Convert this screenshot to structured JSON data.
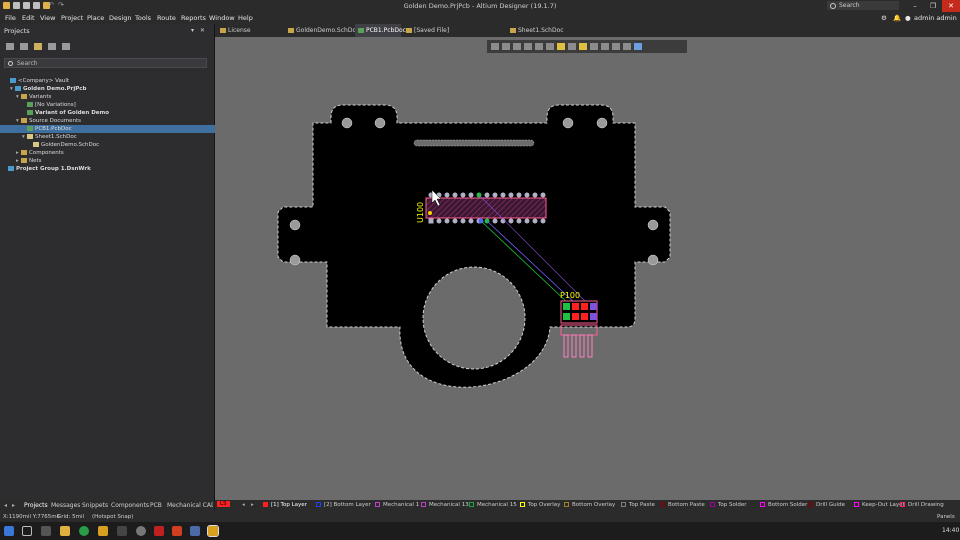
{
  "window": {
    "title": "Golden Demo.PrjPcb - Altium Designer (19.1.7)",
    "search_placeholder": "Search",
    "buttons": {
      "minimize": "–",
      "maximize": "❐",
      "close": "✕"
    }
  },
  "menu": {
    "items": [
      "File",
      "Edit",
      "View",
      "Project",
      "Place",
      "Design",
      "Tools",
      "Route",
      "Reports",
      "Window",
      "Help"
    ],
    "user": "admin admin"
  },
  "projects_panel": {
    "title": "Projects",
    "controls": "▾ ✕",
    "search_placeholder": "Search",
    "tree": [
      {
        "label": "<Company> Vault"
      },
      {
        "label": "Golden Demo.PrjPcb"
      },
      {
        "label": "Variants"
      },
      {
        "label": "[No Variations]"
      },
      {
        "label": "Variant of Golden Demo"
      },
      {
        "label": "Source Documents"
      },
      {
        "label": "PCB1.PcbDoc"
      },
      {
        "label": "Sheet1.SchDoc"
      },
      {
        "label": "GoldenDemo.SchDoc"
      },
      {
        "label": "Components"
      },
      {
        "label": "Nets"
      },
      {
        "label": "Project Group 1.DsnWrk"
      }
    ],
    "tabs": [
      "Projects",
      "Messages",
      "Snippets",
      "Components",
      "PCB",
      "Mechanical CAD C"
    ]
  },
  "doc_tabs": [
    {
      "label": "License Management"
    },
    {
      "label": "GoldenDemo.SchDoc"
    },
    {
      "label": "PCB1.PcbDoc"
    },
    {
      "label": "[Saved File] GoldenDemo.SchDoc *"
    },
    {
      "label": "Sheet1.SchDoc"
    }
  ],
  "pcb": {
    "designator_u": "U100",
    "designator_p": "P100"
  },
  "layers": {
    "current": "LS",
    "items": [
      {
        "label": "[1] Top Layer",
        "color": "#ff2020"
      },
      {
        "label": "[2] Bottom Layer",
        "color": "#2040ff"
      },
      {
        "label": "Mechanical 1",
        "color": "#c040c0"
      },
      {
        "label": "Mechanical 13",
        "color": "#c040c0"
      },
      {
        "label": "Mechanical 15",
        "color": "#20a040"
      },
      {
        "label": "Top Overlay",
        "color": "#ffff00"
      },
      {
        "label": "Bottom Overlay",
        "color": "#a08020"
      },
      {
        "label": "Top Paste",
        "color": "#808080"
      },
      {
        "label": "Bottom Paste",
        "color": "#800000"
      },
      {
        "label": "Top Solder",
        "color": "#a000a0"
      },
      {
        "label": "Bottom Solder",
        "color": "#ff00ff"
      },
      {
        "label": "Drill Guide",
        "color": "#800000"
      },
      {
        "label": "Keep-Out Layer",
        "color": "#ff00ff"
      },
      {
        "label": "Drill Drawing",
        "color": "#ff2060"
      }
    ]
  },
  "status": {
    "coords": "X:1190mil Y:7765mil",
    "grid": "Grid: 5mil",
    "snap": "(Hotspot Snap)",
    "panels_button": "Panels"
  },
  "taskbar": {
    "clock": "14:40"
  }
}
